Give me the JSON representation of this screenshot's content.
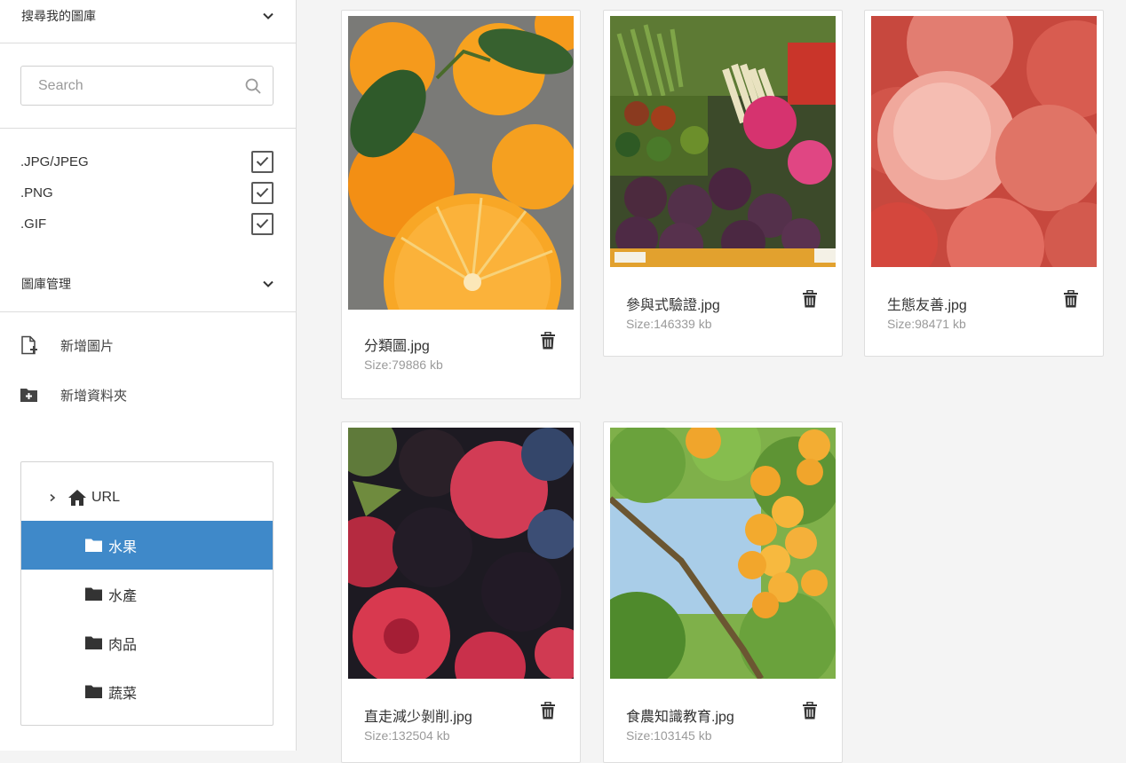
{
  "sidebar": {
    "search_section": {
      "title": "搜尋我的圖庫"
    },
    "search": {
      "placeholder": "Search"
    },
    "filters": [
      {
        "label": ".JPG/JPEG",
        "checked": true
      },
      {
        "label": ".PNG",
        "checked": true
      },
      {
        "label": ".GIF",
        "checked": true
      }
    ],
    "manage_section": {
      "title": "圖庫管理"
    },
    "actions": [
      {
        "label": "新增圖片",
        "icon": "add-file-icon"
      },
      {
        "label": "新增資料夾",
        "icon": "add-folder-icon"
      }
    ],
    "tree": {
      "root": {
        "label": "URL",
        "icon": "home-icon"
      },
      "folders": [
        {
          "label": "水果",
          "active": true
        },
        {
          "label": "水產",
          "active": false
        },
        {
          "label": "肉品",
          "active": false
        },
        {
          "label": "蔬菜",
          "active": false
        }
      ]
    }
  },
  "gallery": {
    "items": [
      {
        "name": "分類圖.jpg",
        "size": "Size:79886 kb",
        "image": "oranges"
      },
      {
        "name": "參與式驗證.jpg",
        "size": "Size:146339 kb",
        "image": "market-produce"
      },
      {
        "name": "生態友善.jpg",
        "size": "Size:98471 kb",
        "image": "peaches"
      },
      {
        "name": "直走減少剝削.jpg",
        "size": "Size:132504 kb",
        "image": "berries"
      },
      {
        "name": "食農知識教育.jpg",
        "size": "Size:103145 kb",
        "image": "apricot-tree"
      }
    ]
  },
  "colors": {
    "accent": "#3f89c9",
    "border": "#dcdcdc",
    "muted_text": "#9a9a9a"
  }
}
